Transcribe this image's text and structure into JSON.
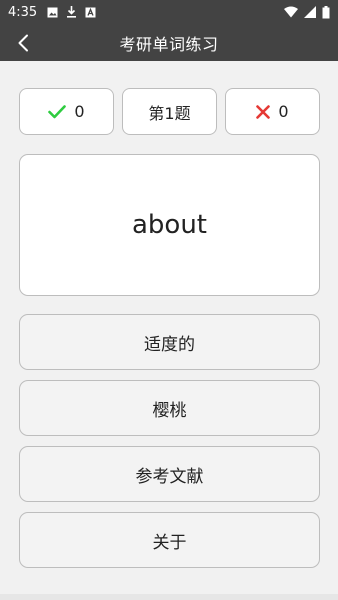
{
  "status_bar": {
    "time": "4:35",
    "icons_left": [
      "image-icon",
      "download-icon",
      "app-a-icon"
    ],
    "icons_right": [
      "wifi-icon",
      "signal-icon",
      "battery-icon"
    ]
  },
  "app_bar": {
    "title": "考研单词练习",
    "back_icon": "chevron-left-icon"
  },
  "score": {
    "correct_count": "0",
    "question_label": "第1题",
    "wrong_count": "0"
  },
  "word": "about",
  "options": [
    "适度的",
    "樱桃",
    "参考文献",
    "关于"
  ],
  "colors": {
    "bar": "#434343",
    "correct": "#2ecc40",
    "wrong": "#e53935"
  }
}
